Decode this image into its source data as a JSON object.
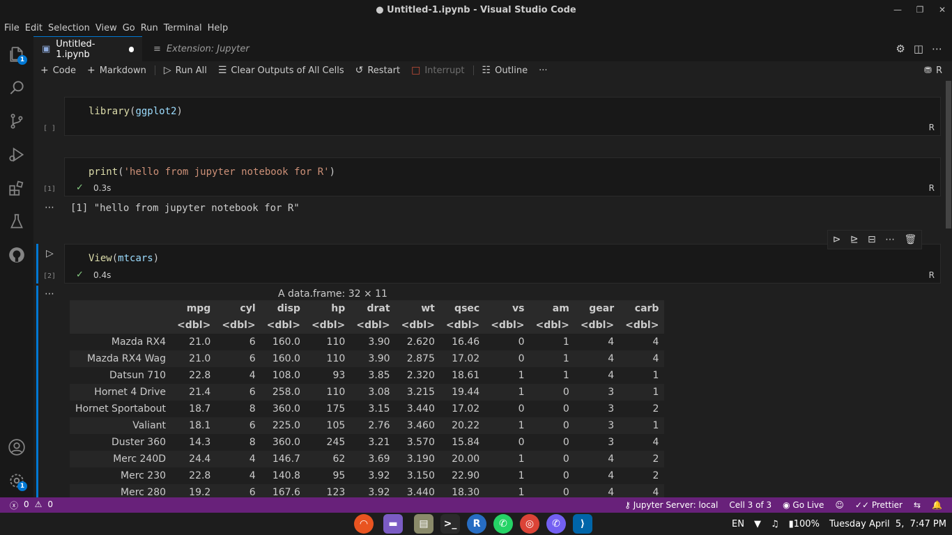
{
  "window": {
    "title": "● Untitled-1.ipynb - Visual Studio Code"
  },
  "menu": [
    "File",
    "Edit",
    "Selection",
    "View",
    "Go",
    "Run",
    "Terminal",
    "Help"
  ],
  "activity": {
    "explorer_badge": "1",
    "settings_badge": "1"
  },
  "tabs": {
    "active": "Untitled-1.ipynb",
    "inactive": "Extension: Jupyter"
  },
  "toolbar": {
    "code": "Code",
    "markdown": "Markdown",
    "run_all": "Run All",
    "clear": "Clear Outputs of All Cells",
    "restart": "Restart",
    "interrupt": "Interrupt",
    "outline": "Outline",
    "more": "···",
    "kernel": "R"
  },
  "cells": [
    {
      "code_fn": "library",
      "code_arg": "ggplot2",
      "count": "[ ]",
      "lang": "R"
    },
    {
      "code_fn": "print",
      "code_arg": "'hello from jupyter notebook for R'",
      "count": "[1]",
      "time": "0.3s",
      "lang": "R",
      "output": "[1] \"hello from jupyter notebook for R\""
    },
    {
      "code_fn": "View",
      "code_arg": "mtcars",
      "count": "[2]",
      "time": "0.4s",
      "lang": "R"
    }
  ],
  "dataframe": {
    "caption": "A data.frame: 32 × 11",
    "columns": [
      "mpg",
      "cyl",
      "disp",
      "hp",
      "drat",
      "wt",
      "qsec",
      "vs",
      "am",
      "gear",
      "carb"
    ],
    "type": "<dbl>",
    "rows": [
      [
        "Mazda RX4",
        "21.0",
        "6",
        "160.0",
        "110",
        "3.90",
        "2.620",
        "16.46",
        "0",
        "1",
        "4",
        "4"
      ],
      [
        "Mazda RX4 Wag",
        "21.0",
        "6",
        "160.0",
        "110",
        "3.90",
        "2.875",
        "17.02",
        "0",
        "1",
        "4",
        "4"
      ],
      [
        "Datsun 710",
        "22.8",
        "4",
        "108.0",
        "93",
        "3.85",
        "2.320",
        "18.61",
        "1",
        "1",
        "4",
        "1"
      ],
      [
        "Hornet 4 Drive",
        "21.4",
        "6",
        "258.0",
        "110",
        "3.08",
        "3.215",
        "19.44",
        "1",
        "0",
        "3",
        "1"
      ],
      [
        "Hornet Sportabout",
        "18.7",
        "8",
        "360.0",
        "175",
        "3.15",
        "3.440",
        "17.02",
        "0",
        "0",
        "3",
        "2"
      ],
      [
        "Valiant",
        "18.1",
        "6",
        "225.0",
        "105",
        "2.76",
        "3.460",
        "20.22",
        "1",
        "0",
        "3",
        "1"
      ],
      [
        "Duster 360",
        "14.3",
        "8",
        "360.0",
        "245",
        "3.21",
        "3.570",
        "15.84",
        "0",
        "0",
        "3",
        "4"
      ],
      [
        "Merc 240D",
        "24.4",
        "4",
        "146.7",
        "62",
        "3.69",
        "3.190",
        "20.00",
        "1",
        "0",
        "4",
        "2"
      ],
      [
        "Merc 230",
        "22.8",
        "4",
        "140.8",
        "95",
        "3.92",
        "3.150",
        "22.90",
        "1",
        "0",
        "4",
        "2"
      ],
      [
        "Merc 280",
        "19.2",
        "6",
        "167.6",
        "123",
        "3.92",
        "3.440",
        "18.30",
        "1",
        "0",
        "4",
        "4"
      ]
    ]
  },
  "statusbar": {
    "errors": "0",
    "warnings": "0",
    "jupyter": "Jupyter Server: local",
    "cell": "Cell 3 of 3",
    "golive": "Go Live",
    "prettier": "Prettier"
  },
  "taskbar": {
    "lang": "EN",
    "battery": "100%",
    "clock": "Tuesday April  5,  7:47 PM"
  },
  "colors": {
    "accent": "#0078d4",
    "statusbar": "#68217a"
  }
}
